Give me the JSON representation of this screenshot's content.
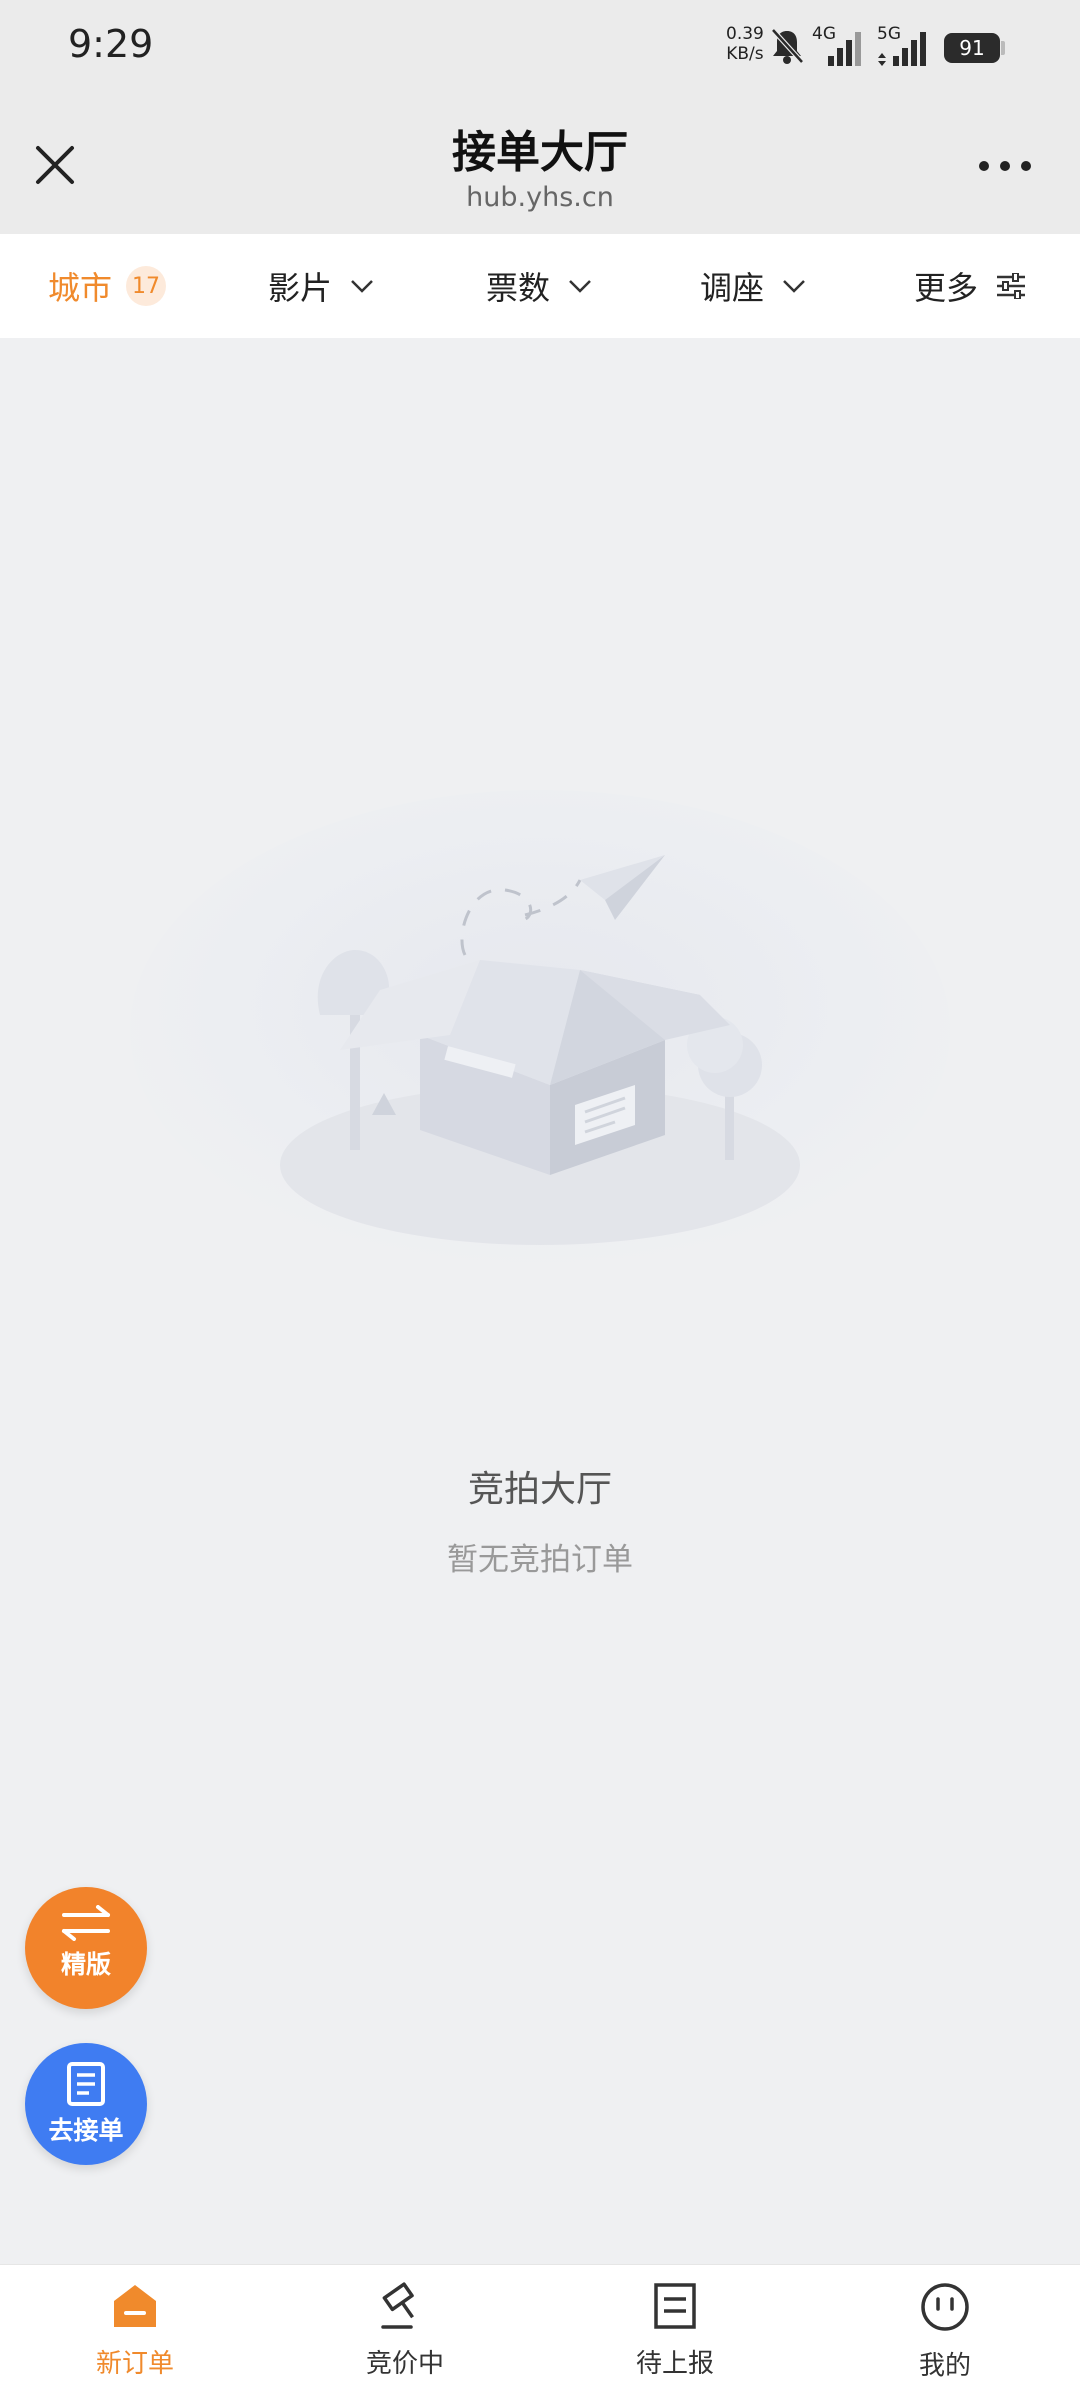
{
  "status_bar": {
    "time": "9:29",
    "net_speed_value": "0.39",
    "net_speed_unit": "KB/s",
    "network_4g": "4G",
    "network_5g": "5G",
    "battery": "91"
  },
  "nav": {
    "title": "接单大厅",
    "subtitle": "hub.yhs.cn"
  },
  "filters": {
    "city_label": "城市",
    "city_count": "17",
    "film_label": "影片",
    "tickets_label": "票数",
    "seat_label": "调座",
    "more_label": "更多"
  },
  "empty_state": {
    "title": "竞拍大厅",
    "subtitle": "暂无竞拍订单"
  },
  "fab": {
    "lite_label": "精版",
    "take_order_label": "去接单"
  },
  "tabs": [
    {
      "label": "新订单",
      "icon": "home-icon"
    },
    {
      "label": "竞价中",
      "icon": "gavel-icon"
    },
    {
      "label": "待上报",
      "icon": "document-icon"
    },
    {
      "label": "我的",
      "icon": "profile-icon"
    }
  ],
  "colors": {
    "accent": "#f08a2c",
    "fab_lite": "#f2832b",
    "fab_take": "#3f7cf2",
    "background": "#eff0f2"
  }
}
